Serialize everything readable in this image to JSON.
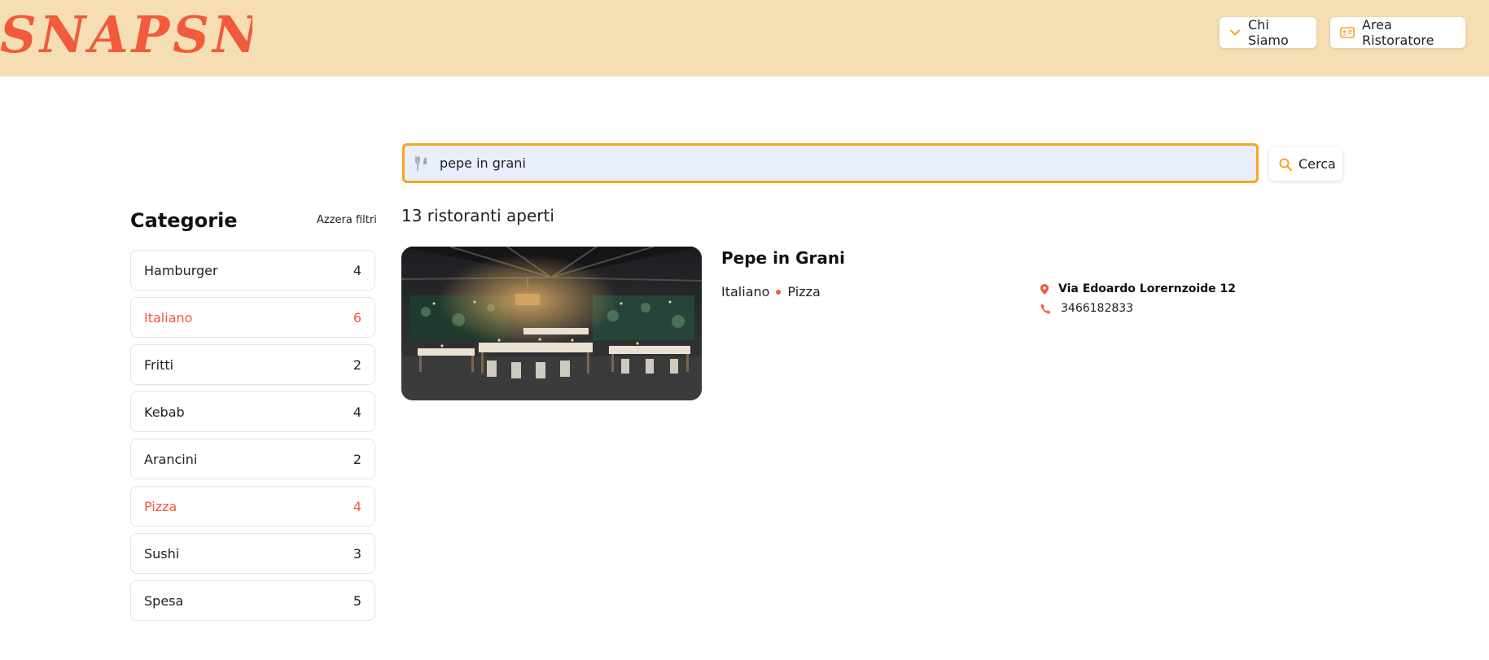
{
  "header": {
    "logo_text": "SNAPSNACK",
    "nav": [
      {
        "label": "Chi Siamo",
        "icon": "chevron-down-icon"
      },
      {
        "label": "Area Ristoratore",
        "icon": "id-card-icon"
      }
    ]
  },
  "search": {
    "value": "pepe in grani",
    "button_label": "Cerca",
    "icon": "utensils-icon"
  },
  "sidebar": {
    "title": "Categorie",
    "reset_label": "Azzera filtri",
    "categories": [
      {
        "label": "Hamburger",
        "count": "4",
        "active": false
      },
      {
        "label": "Italiano",
        "count": "6",
        "active": true
      },
      {
        "label": "Fritti",
        "count": "2",
        "active": false
      },
      {
        "label": "Kebab",
        "count": "4",
        "active": false
      },
      {
        "label": "Arancini",
        "count": "2",
        "active": false
      },
      {
        "label": "Pizza",
        "count": "4",
        "active": true
      },
      {
        "label": "Sushi",
        "count": "3",
        "active": false
      },
      {
        "label": "Spesa",
        "count": "5",
        "active": false
      }
    ]
  },
  "results": {
    "count_label": "13 ristoranti aperti",
    "items": [
      {
        "name": "Pepe in Grani",
        "tags": [
          "Italiano",
          "Pizza"
        ],
        "address": "Via Edoardo Lorernzoide 12",
        "phone": "3466182833"
      }
    ]
  },
  "colors": {
    "header_bg": "#f5deb3",
    "brand": "#f15a3a",
    "accent": "#f5a623",
    "search_bg": "#e8eefb"
  }
}
